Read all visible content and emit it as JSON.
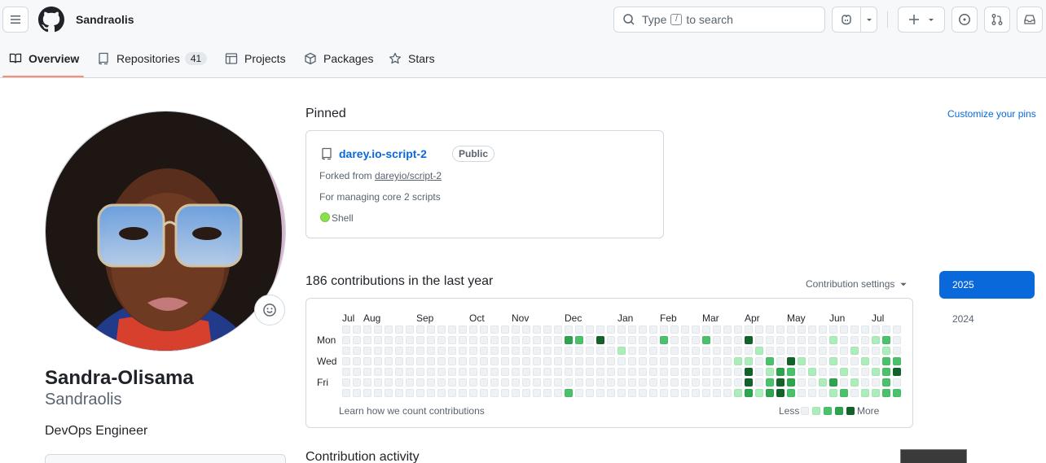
{
  "header": {
    "username": "Sandraolis",
    "search_before": "Type",
    "search_key": "/",
    "search_after": "to search"
  },
  "tabs": [
    {
      "label": "Overview"
    },
    {
      "label": "Repositories",
      "count": "41"
    },
    {
      "label": "Projects"
    },
    {
      "label": "Packages"
    },
    {
      "label": "Stars"
    }
  ],
  "profile": {
    "full_name": "Sandra-Olisama",
    "login": "Sandraolis",
    "bio": "DevOps Engineer"
  },
  "pinned": {
    "title": "Pinned",
    "customize_label": "Customize your pins",
    "repo": {
      "name": "darey.io-script-2",
      "visibility": "Public",
      "forked_prefix": "Forked from",
      "forked_source": "dareyio/script-2",
      "description": "For managing core 2 scripts",
      "language": "Shell",
      "language_color": "#89e051"
    }
  },
  "contributions": {
    "title": "186 contributions in the last year",
    "settings_label": "Contribution settings",
    "months": [
      "Jul",
      "Aug",
      "Sep",
      "Oct",
      "Nov",
      "Dec",
      "Jan",
      "Feb",
      "Mar",
      "Apr",
      "May",
      "Jun",
      "Jul"
    ],
    "day_labels": [
      "Mon",
      "Wed",
      "Fri"
    ],
    "learn_label": "Learn how we count contributions",
    "less_label": "Less",
    "more_label": "More",
    "level_colors": [
      "#eff2f5",
      "#aceebb",
      "#4ac26b",
      "#2da44e",
      "#116329"
    ],
    "active_cells": [
      [
        21,
        1,
        3
      ],
      [
        22,
        1,
        2
      ],
      [
        24,
        1,
        4
      ],
      [
        26,
        2,
        1
      ],
      [
        30,
        1,
        2
      ],
      [
        34,
        1,
        2
      ],
      [
        38,
        1,
        4
      ],
      [
        38,
        4,
        4
      ],
      [
        38,
        5,
        4
      ],
      [
        38,
        6,
        3
      ],
      [
        38,
        3,
        1
      ],
      [
        40,
        3,
        2
      ],
      [
        40,
        4,
        1
      ],
      [
        40,
        5,
        2
      ],
      [
        40,
        6,
        3
      ],
      [
        41,
        4,
        3
      ],
      [
        41,
        5,
        4
      ],
      [
        41,
        6,
        4
      ],
      [
        42,
        3,
        4
      ],
      [
        42,
        4,
        2
      ],
      [
        42,
        5,
        3
      ],
      [
        42,
        6,
        2
      ],
      [
        39,
        2,
        1
      ],
      [
        39,
        6,
        1
      ],
      [
        37,
        3,
        1
      ],
      [
        37,
        6,
        1
      ],
      [
        43,
        3,
        1
      ],
      [
        44,
        4,
        1
      ],
      [
        45,
        5,
        1
      ],
      [
        46,
        1,
        1
      ],
      [
        46,
        3,
        1
      ],
      [
        46,
        5,
        3
      ],
      [
        46,
        6,
        1
      ],
      [
        47,
        4,
        1
      ],
      [
        47,
        6,
        2
      ],
      [
        48,
        2,
        1
      ],
      [
        48,
        5,
        1
      ],
      [
        49,
        3,
        1
      ],
      [
        49,
        6,
        1
      ],
      [
        50,
        1,
        1
      ],
      [
        50,
        4,
        1
      ],
      [
        50,
        6,
        1
      ],
      [
        51,
        1,
        2
      ],
      [
        51,
        2,
        1
      ],
      [
        51,
        3,
        2
      ],
      [
        51,
        4,
        2
      ],
      [
        51,
        5,
        2
      ],
      [
        51,
        6,
        2
      ],
      [
        51,
        7,
        2
      ],
      [
        52,
        3,
        2
      ],
      [
        52,
        4,
        4
      ],
      [
        52,
        6,
        2
      ],
      [
        21,
        6,
        2
      ],
      [
        21,
        7,
        2
      ],
      [
        28,
        7,
        1
      ],
      [
        32,
        7,
        1
      ],
      [
        36,
        7,
        4
      ],
      [
        39,
        7,
        3
      ],
      [
        40,
        7,
        2
      ],
      [
        41,
        7,
        3
      ],
      [
        42,
        7,
        1
      ]
    ],
    "year_selected": "2025",
    "year_other": "2024"
  },
  "activity": {
    "title": "Contribution activity"
  }
}
